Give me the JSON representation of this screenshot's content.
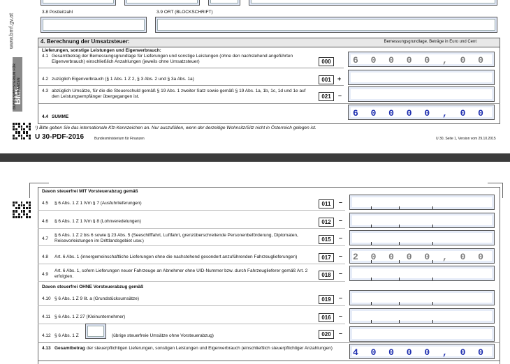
{
  "page1": {
    "side_url": "www.bmf.gv.at",
    "ministry_side": "BUNDESMINISTERIUM FÜR FINANZEN",
    "bmf_logo": "BMF",
    "postcode_label": "3.8  Postleitzahl",
    "city_label": "3.9  ORT (BLOCKSCHRIFT)",
    "section_title": "4.  Berechnung der Umsatzsteuer:",
    "section_note": "Bemessungsgrundlage, Beträge in Euro und Cent",
    "supplies_heading": "Lieferungen, sonstige Leistungen und Eigenverbrauch:",
    "rows": [
      {
        "num": "4.1",
        "text": "Gesamtbetrag der Bemessungsgrundlage für Lieferungen und sonstige Leistungen (ohne den nachstehend angeführten Eigenverbrauch) einschließlich Anzahlungen (jeweils ohne Umsatzsteuer)",
        "code": "000",
        "sign": "",
        "value": "6 0 0 0 0 , 0 0"
      },
      {
        "num": "4.2",
        "text": "zuzüglich Eigenverbrauch (§ 1 Abs. 1 Z 2, § 3 Abs. 2 und § 3a Abs. 1a)",
        "code": "001",
        "sign": "+",
        "value": ""
      },
      {
        "num": "4.3",
        "text": "abzüglich Umsätze, für die die Steuerschuld gemäß § 19 Abs. 1 zweiter Satz sowie gemäß § 19 Abs. 1a, 1b, 1c, 1d und 1e auf den Leistungsempfänger übergegangen ist.",
        "code": "021",
        "sign": "–",
        "value": ""
      }
    ],
    "sum_num": "4.4",
    "sum_label": "SUMME",
    "sum_value": "6 0 0 0 0 , 0 0",
    "footnote": "¹) Bitte geben Sie das internationale Kfz-Kennzeichen an. Nur auszufüllen, wenn der derzeitige Wohnsitz/Sitz nicht in Österreich gelegen ist.",
    "form_id": "U 30-PDF-2016",
    "form_ministry": "Bundesministerium für Finanzen",
    "version": "U 30, Seite 1, Version vom 29.10.2015"
  },
  "page2": {
    "heading_with": "Davon steuerfrei MIT Vorsteuerabzug gemäß",
    "rows_with": [
      {
        "num": "4.5",
        "text": "§ 6 Abs. 1 Z 1 iVm § 7 (Ausfuhrlieferungen)",
        "code": "011",
        "value": ""
      },
      {
        "num": "4.6",
        "text": "§ 6 Abs. 1 Z 1 iVm § 8 (Lohnveredelungen)",
        "code": "012",
        "value": ""
      },
      {
        "num": "4.7",
        "text": "§ 6 Abs. 1 Z 2 bis 6 sowie § 23 Abs. 5 (Seeschifffahrt, Luftfahrt, grenzüberschreitende Personenbeförderung, Diplomaten, Reisevorleistungen im Drittlandsgebiet usw.)",
        "code": "015",
        "value": ""
      },
      {
        "num": "4.8",
        "text": "Art. 6 Abs. 1 (innergemeinschaftliche Lieferungen ohne die nachstehend gesondert anzuführenden Fahrzeuglieferungen)",
        "code": "017",
        "value": "2 0 0 0 0 , 0 0"
      },
      {
        "num": "4.9",
        "text": "Art. 6 Abs. 1, sofern Lieferungen neuer Fahrzeuge an Abnehmer ohne UID-Nummer bzw. durch Fahrzeuglieferer gemäß Art. 2 erfolgten.",
        "code": "018",
        "value": ""
      }
    ],
    "heading_without": "Davon steuerfrei OHNE Vorsteuerabzug gemäß",
    "rows_without": [
      {
        "num": "4.10",
        "text": "§ 6 Abs. 1 Z 9 lit. a (Grundstücksumsätze)",
        "code": "019",
        "value": ""
      },
      {
        "num": "4.11",
        "text": "§ 6 Abs. 1 Z 27 (Kleinunternehmer)",
        "code": "016",
        "value": ""
      }
    ],
    "row_412": {
      "num": "4.12",
      "text_before": "§ 6 Abs. 1 Z",
      "text_after": "(übrige steuerfreie Umsätze ohne Vorsteuerabzug)",
      "code": "020",
      "value": ""
    },
    "total": {
      "num": "4.13",
      "bold": "Gesamtbetrag",
      "text": "der steuerpflichtigen Lieferungen, sonstigen Leistungen und Eigenverbrauch (einschließlich steuerpflichtiger Anzahlungen)",
      "value": "4 0 0 0 0 , 0 0"
    },
    "minus_sign": "–"
  },
  "colors": {
    "field_bg": "#dfe6f6",
    "value_gray": "#7c7c7c",
    "value_blue": "#1e2fb0",
    "section_bg": "#e8e8e8",
    "viewer_bg": "#3b3b3b"
  }
}
